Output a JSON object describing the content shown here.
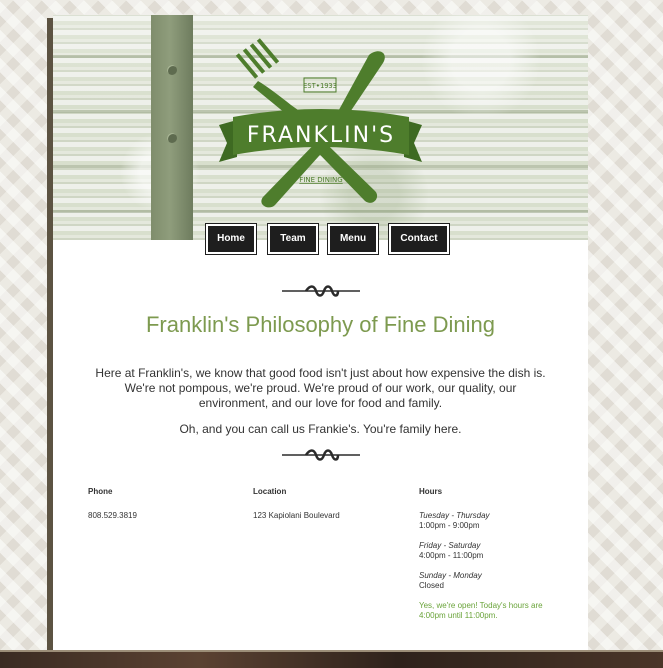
{
  "brand": {
    "logo_name": "FRANKLIN'S",
    "logo_est": "EST•1933",
    "logo_tagline": "FINE DINING",
    "logo_color": "#4e7d2c"
  },
  "nav": {
    "items": [
      {
        "label": "Home"
      },
      {
        "label": "Team"
      },
      {
        "label": "Menu"
      },
      {
        "label": "Contact"
      }
    ]
  },
  "philosophy": {
    "title": "Franklin's Philosophy of Fine Dining",
    "paragraph1_line1": "Here at Franklin's, we know that good food isn't just about how expensive the dish is.",
    "paragraph1_line2": "We're not pompous, we're proud. We're proud of our work, our quality, our",
    "paragraph1_line3": "environment, and our love for food and family.",
    "paragraph2": "Oh, and you can call us Frankie's. You're family here."
  },
  "info": {
    "phone_label": "Phone",
    "phone_value": "808.529.3819",
    "location_label": "Location",
    "location_value": "123 Kapiolani Boulevard",
    "hours_label": "Hours",
    "hours": [
      {
        "days": "Tuesday - Thursday",
        "time": "1:00pm - 9:00pm"
      },
      {
        "days": "Friday - Saturday",
        "time": "4:00pm - 11:00pm"
      },
      {
        "days": "Sunday - Monday",
        "time": "Closed"
      }
    ],
    "open_line1": "Yes, we're open! Today's hours are",
    "open_line2": "4:00pm until 11:00pm."
  },
  "colors": {
    "accent_green": "#7d9a4f",
    "open_green": "#6aa43a",
    "nav_bg": "#1e1e1e"
  }
}
